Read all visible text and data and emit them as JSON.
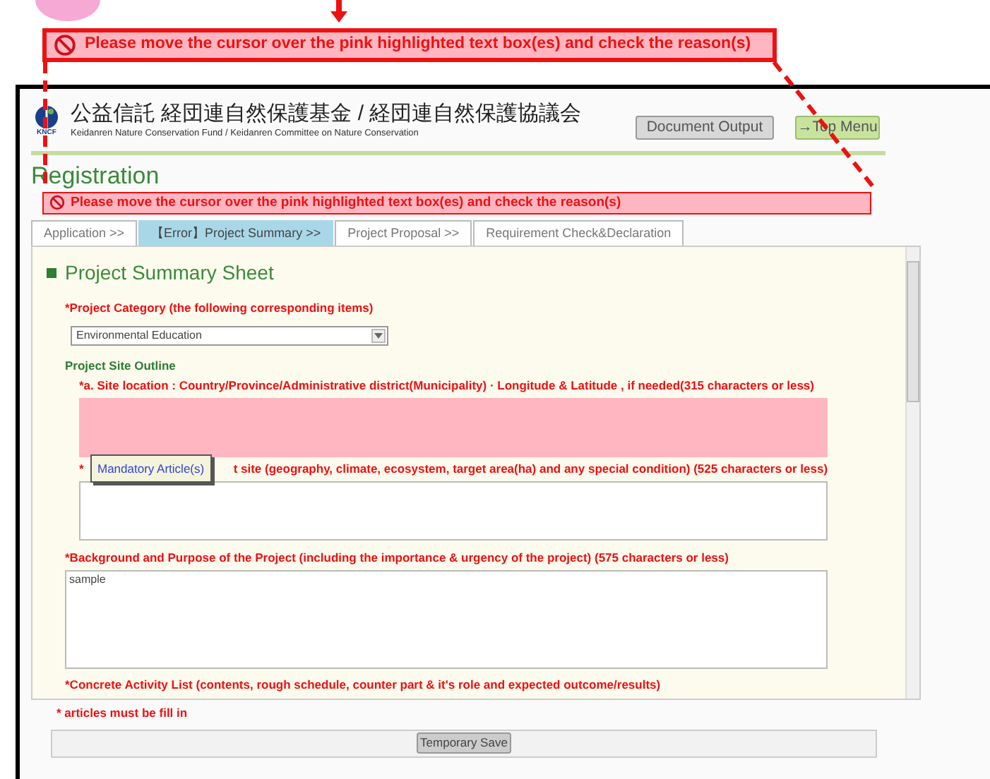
{
  "callout": {
    "text": "Please move the cursor over the pink highlighted text box(es) and check the reason(s)"
  },
  "header": {
    "title_jp": "公益信託 経団連自然保護基金 / 経団連自然保護協議会",
    "subtitle": "Keidanren Nature Conservation Fund / Keidanren Committee on Nature Conservation",
    "logo_text": "KNCF",
    "buttons": [
      {
        "label": "Document Output",
        "kind": "gray"
      },
      {
        "label": "→Top Menu",
        "kind": "green"
      }
    ]
  },
  "page_title": "Registration",
  "error_banner": "Please move the cursor over the pink highlighted text box(es) and check the reason(s)",
  "tabs": [
    {
      "label": "Application >>",
      "selected": false
    },
    {
      "label": "【Error】Project Summary >>",
      "selected": true
    },
    {
      "label": "Project Proposal >>",
      "selected": false
    },
    {
      "label": "Requirement Check&Declaration",
      "selected": false
    }
  ],
  "sheet_title": "Project Summary Sheet",
  "category": {
    "label": "*Project Category (the following corresponding items)",
    "value": "Environmental Education"
  },
  "site_outline": "Project Site Outline",
  "fields": [
    {
      "label": "*a. Site location : Country/Province/Administrative district(Municipality) · Longitude & Latitude , if needed(315 characters or less)",
      "error": true,
      "kind": "indented"
    },
    {
      "label_prefix": "*",
      "label": "t site (geography, climate, ecosystem, target area(ha) and any special condition) (525 characters or less)",
      "error": false,
      "kind": "indented",
      "tooltip": "Mandatory Article(s)"
    },
    {
      "label": "*Background and Purpose of the Project (including the importance & urgency of the project) (575 characters or less)",
      "value": "sample",
      "error": false,
      "kind": "plain"
    }
  ],
  "next_label": "*Concrete Activity List  (contents, rough schedule, counter part & it's role and expected outcome/results)",
  "required_note": "* articles must be fill in",
  "save_button": "Temporary Save"
}
